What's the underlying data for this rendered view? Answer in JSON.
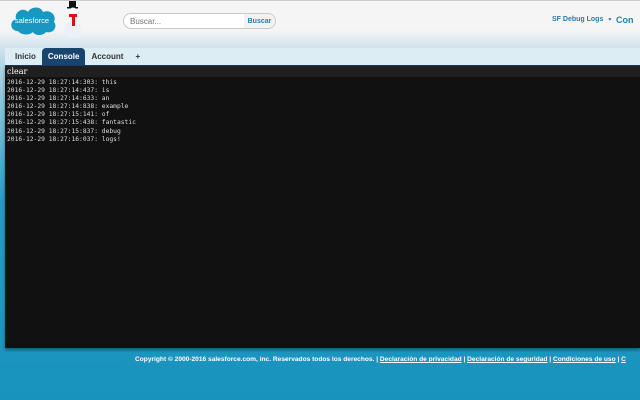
{
  "header": {
    "logo_text": "salesforce",
    "search_placeholder": "Buscar...",
    "search_button": "Buscar",
    "user_menu": "SF Debug Logs",
    "next_link": "Con"
  },
  "tabs": [
    {
      "label": "Inicio"
    },
    {
      "label": "Console",
      "active": true
    },
    {
      "label": "Account"
    },
    {
      "label": "+"
    }
  ],
  "console": {
    "clear_label": "clear",
    "logs": [
      "2016-12-29 18:27:14:303: this",
      "2016-12-29 18:27:14:437: is",
      "2016-12-29 18:27:14:633: an",
      "2016-12-29 18:27:14:838: example",
      "2016-12-29 18:27:15:141: of",
      "2016-12-29 18:27:15:438: fantastic",
      "2016-12-29 18:27:15:837: debug",
      "2016-12-29 18:27:16:037: logs!"
    ]
  },
  "footer": {
    "copyright": "Copyright © 2000-2016 salesforce.com, inc. Reservados todos los derechos.",
    "links": [
      "Declaración de privacidad",
      "Declaración de seguridad",
      "Condiciones de uso",
      "C"
    ]
  },
  "colors": {
    "brand": "#1798c1",
    "tab_active": "#1a4470",
    "console_bg": "#111111"
  }
}
